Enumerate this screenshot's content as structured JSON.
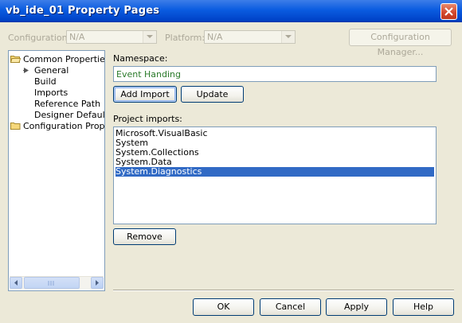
{
  "window": {
    "title": "vb_ide_01 Property Pages"
  },
  "top_bar": {
    "configuration_label": "Configuration:",
    "configuration_value": "N/A",
    "platform_label": "Platform:",
    "platform_value": "N/A",
    "config_manager_label": "Configuration Manager..."
  },
  "tree": {
    "items": [
      {
        "label": "Common Properties",
        "icon": "folder-open-icon"
      },
      {
        "label": "General",
        "icon": "arrow-right-icon"
      },
      {
        "label": "Build"
      },
      {
        "label": "Imports"
      },
      {
        "label": "Reference Path"
      },
      {
        "label": "Designer Defaults"
      },
      {
        "label": "Configuration Properties",
        "icon": "folder-icon"
      }
    ]
  },
  "namespace": {
    "label": "Namespace:",
    "value": "Event Handing"
  },
  "buttons": {
    "add_import": "Add Import",
    "update": "Update",
    "remove": "Remove",
    "ok": "OK",
    "cancel": "Cancel",
    "apply": "Apply",
    "help": "Help"
  },
  "imports": {
    "label": "Project imports:",
    "items": [
      "Microsoft.VisualBasic",
      "System",
      "System.Collections",
      "System.Data",
      "System.Diagnostics"
    ],
    "selected_index": 4
  },
  "colors": {
    "title_bar": "#0A5BE0",
    "dialog_bg": "#ECE9D8",
    "selection": "#316AC5",
    "close_button": "#D2452A"
  }
}
